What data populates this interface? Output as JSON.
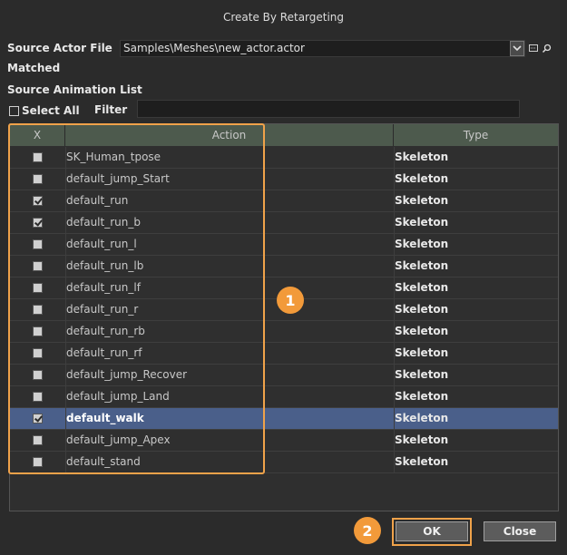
{
  "dialog": {
    "title": "Create By Retargeting"
  },
  "source": {
    "label": "Source Actor File",
    "value": "Samples\\Meshes\\new_actor.actor",
    "status": "Matched",
    "icons": [
      "chevron-down-icon",
      "browse-icon",
      "search-icon"
    ]
  },
  "animation_list": {
    "label": "Source Animation List",
    "select_all_label": "Select All",
    "select_all_checked": false,
    "filter_label": "Filter",
    "filter_value": ""
  },
  "table": {
    "headers": {
      "check": "X",
      "action": "Action",
      "type": "Type"
    },
    "rows": [
      {
        "checked": false,
        "action": "SK_Human_tpose",
        "type": "Skeleton",
        "selected": false
      },
      {
        "checked": false,
        "action": "default_jump_Start",
        "type": "Skeleton",
        "selected": false
      },
      {
        "checked": true,
        "action": "default_run",
        "type": "Skeleton",
        "selected": false
      },
      {
        "checked": true,
        "action": "default_run_b",
        "type": "Skeleton",
        "selected": false
      },
      {
        "checked": false,
        "action": "default_run_l",
        "type": "Skeleton",
        "selected": false
      },
      {
        "checked": false,
        "action": "default_run_lb",
        "type": "Skeleton",
        "selected": false
      },
      {
        "checked": false,
        "action": "default_run_lf",
        "type": "Skeleton",
        "selected": false
      },
      {
        "checked": false,
        "action": "default_run_r",
        "type": "Skeleton",
        "selected": false
      },
      {
        "checked": false,
        "action": "default_run_rb",
        "type": "Skeleton",
        "selected": false
      },
      {
        "checked": false,
        "action": "default_run_rf",
        "type": "Skeleton",
        "selected": false
      },
      {
        "checked": false,
        "action": "default_jump_Recover",
        "type": "Skeleton",
        "selected": false
      },
      {
        "checked": false,
        "action": "default_jump_Land",
        "type": "Skeleton",
        "selected": false
      },
      {
        "checked": true,
        "action": "default_walk",
        "type": "Skeleton",
        "selected": true
      },
      {
        "checked": false,
        "action": "default_jump_Apex",
        "type": "Skeleton",
        "selected": false
      },
      {
        "checked": false,
        "action": "default_stand",
        "type": "Skeleton",
        "selected": false
      }
    ]
  },
  "annotations": {
    "badge_1": "1",
    "badge_2": "2",
    "highlight_color": "#f0a24a"
  },
  "buttons": {
    "ok": "OK",
    "close": "Close"
  },
  "colors": {
    "header_bg": "#4d5a4d",
    "selected_row": "#4a5f8a"
  }
}
